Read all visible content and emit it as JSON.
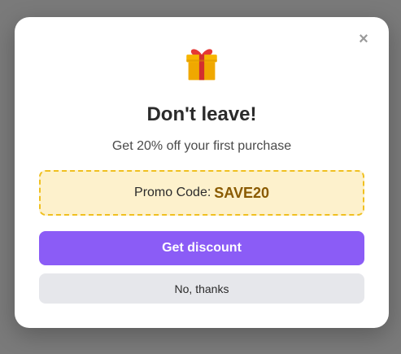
{
  "modal": {
    "close_glyph": "×",
    "gift_icon": "gift-icon",
    "title": "Don't leave!",
    "subtitle": "Get 20% off your first purchase",
    "promo": {
      "label": "Promo Code:",
      "code": "SAVE20"
    },
    "primary_button": "Get discount",
    "secondary_button": "No, thanks"
  },
  "colors": {
    "backdrop": "#7a7a7a",
    "primary": "#8b5cf6",
    "promo_bg": "#fdf1cc",
    "promo_border": "#f0c020",
    "promo_code": "#8a5a00",
    "secondary_bg": "#e6e7eb"
  }
}
